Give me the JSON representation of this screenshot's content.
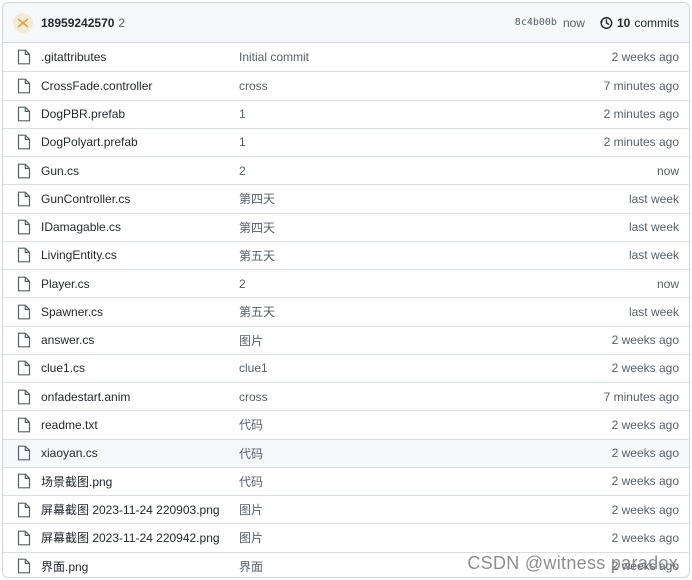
{
  "commit": {
    "author": "18959242570",
    "message": "2",
    "sha": "8c4b00b",
    "time": "now",
    "commits_count": "10",
    "commits_label": "commits"
  },
  "files": [
    {
      "name": ".gitattributes",
      "message": "Initial commit",
      "age": "2 weeks ago"
    },
    {
      "name": "CrossFade.controller",
      "message": "cross",
      "age": "7 minutes ago"
    },
    {
      "name": "DogPBR.prefab",
      "message": "1",
      "age": "2 minutes ago"
    },
    {
      "name": "DogPolyart.prefab",
      "message": "1",
      "age": "2 minutes ago"
    },
    {
      "name": "Gun.cs",
      "message": "2",
      "age": "now"
    },
    {
      "name": "GunController.cs",
      "message": "第四天",
      "age": "last week"
    },
    {
      "name": "IDamagable.cs",
      "message": "第四天",
      "age": "last week"
    },
    {
      "name": "LivingEntity.cs",
      "message": "第五天",
      "age": "last week"
    },
    {
      "name": "Player.cs",
      "message": "2",
      "age": "now"
    },
    {
      "name": "Spawner.cs",
      "message": "第五天",
      "age": "last week"
    },
    {
      "name": "answer.cs",
      "message": "图片",
      "age": "2 weeks ago"
    },
    {
      "name": "clue1.cs",
      "message": "clue1",
      "age": "2 weeks ago"
    },
    {
      "name": "onfadestart.anim",
      "message": "cross",
      "age": "7 minutes ago"
    },
    {
      "name": "readme.txt",
      "message": "代码",
      "age": "2 weeks ago"
    },
    {
      "name": "xiaoyan.cs",
      "message": "代码",
      "age": "2 weeks ago"
    },
    {
      "name": "场景截图.png",
      "message": "代码",
      "age": "2 weeks ago"
    },
    {
      "name": "屏幕截图 2023-11-24 220903.png",
      "message": "图片",
      "age": "2 weeks ago"
    },
    {
      "name": "屏幕截图 2023-11-24 220942.png",
      "message": "图片",
      "age": "2 weeks ago"
    },
    {
      "name": "界面.png",
      "message": "界面",
      "age": "2 weeks ago"
    }
  ],
  "watermark": "CSDN @witness paradox",
  "icons": {
    "file": "file-icon",
    "history": "history-icon",
    "avatar": "avatar-icon"
  },
  "colors": {
    "border": "#d0d7de",
    "header_bg": "#f6f8fa",
    "muted": "#57606a",
    "text": "#24292f"
  }
}
